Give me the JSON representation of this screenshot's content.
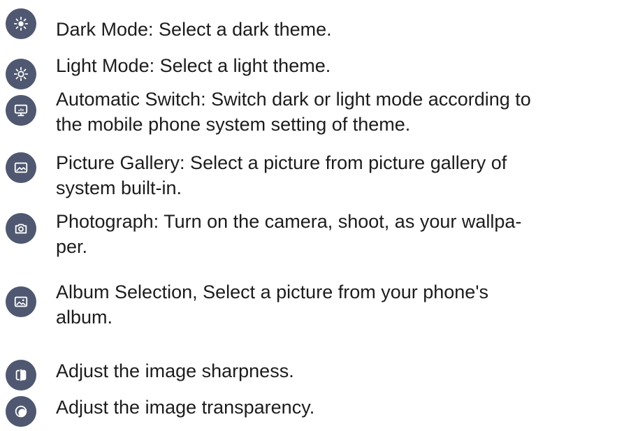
{
  "items": [
    {
      "icon": "sun-dark-mode-icon",
      "text": "Dark Mode: Select a dark theme."
    },
    {
      "icon": "sun-light-mode-icon",
      "text": "Light Mode: Select a light theme."
    },
    {
      "icon": "monitor-icon",
      "text": "Automatic Switch: Switch dark or light mode according to\nthe mobile phone system setting of theme."
    },
    {
      "icon": "image-gallery-icon",
      "text": "Picture Gallery: Select a picture from picture gallery of\nsystem built-in."
    },
    {
      "icon": "camera-icon",
      "text": "Photograph: Turn on the camera, shoot, as your wallpa-\nper."
    },
    {
      "icon": "album-icon",
      "text": "Album Selection, Select a picture from your phone's\nalbum."
    },
    {
      "icon": "sharpness-icon",
      "text": "Adjust the image sharpness."
    },
    {
      "icon": "transparency-icon",
      "text": "Adjust the image transparency."
    }
  ],
  "colors": {
    "icon_bg": "#4f5870",
    "icon_fg": "#ffffff",
    "text": "#1c1c1c"
  }
}
